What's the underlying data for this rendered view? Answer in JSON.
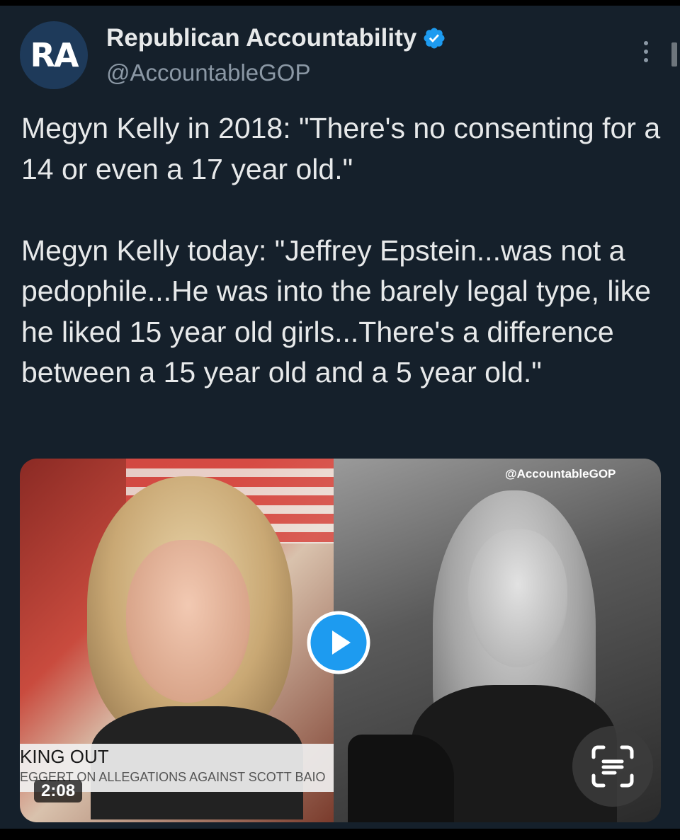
{
  "author": {
    "avatar_text": "RA",
    "display_name": "Republican Accountability",
    "handle": "@AccountableGOP",
    "verified": true
  },
  "tweet": {
    "paragraph_1": "Megyn Kelly in 2018: \"There's no consenting for a 14 or even a 17 year old.\"",
    "paragraph_2": "Megyn Kelly today: \"Jeffrey Epstein...was not a pedophile...He was into the barely legal type, like he liked 15 year old girls...There's a difference between a 15 year old and a 5 year old.\""
  },
  "media": {
    "watermark": "@AccountableGOP",
    "lower_third_title": "KING OUT",
    "lower_third_subtitle": "EGGERT ON ALLEGATIONS AGAINST SCOTT BAIO",
    "duration": "2:08"
  },
  "icons": [
    "verified-icon",
    "more-options-icon",
    "play-icon",
    "lens-scan-icon"
  ],
  "colors": {
    "background": "#15202b",
    "text": "#e7e9ea",
    "secondary_text": "#8b98a5",
    "verified_blue": "#1d9bf0",
    "avatar_bg": "#1e3a5a"
  }
}
